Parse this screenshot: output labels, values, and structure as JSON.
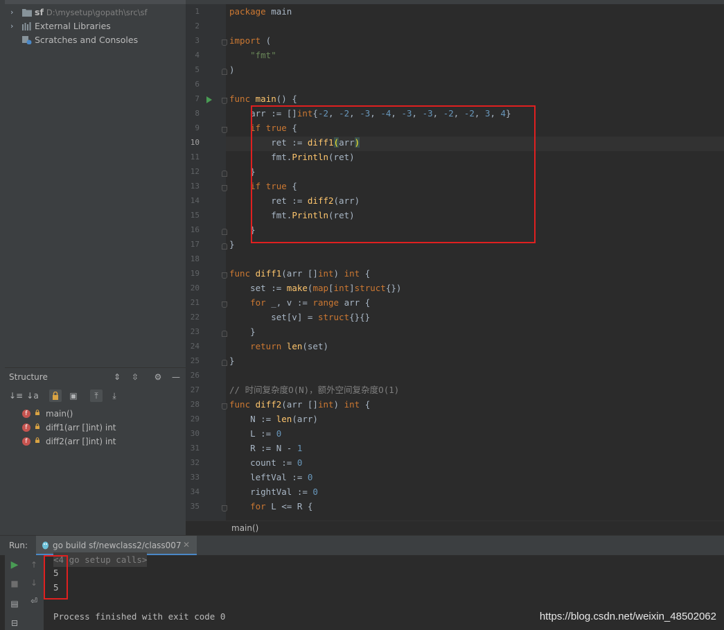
{
  "project": {
    "items": [
      {
        "name": "sf",
        "path": "D:\\mysetup\\gopath\\src\\sf"
      },
      {
        "name": "External Libraries"
      },
      {
        "name": "Scratches and Consoles"
      }
    ]
  },
  "structure": {
    "title": "Structure",
    "items": [
      {
        "badge": "f",
        "label": "main()"
      },
      {
        "badge": "f",
        "label": "diff1(arr []int) int"
      },
      {
        "badge": "f",
        "label": "diff2(arr []int) int"
      }
    ]
  },
  "editor": {
    "current_line": 10,
    "line_numbers": [
      "1",
      "2",
      "3",
      "4",
      "5",
      "6",
      "7",
      "8",
      "9",
      "10",
      "11",
      "12",
      "13",
      "14",
      "15",
      "16",
      "17",
      "18",
      "19",
      "20",
      "21",
      "22",
      "23",
      "24",
      "25",
      "26",
      "27",
      "28",
      "29",
      "30",
      "31",
      "32",
      "33",
      "34",
      "35"
    ],
    "breadcrumb": "main()"
  },
  "run": {
    "label": "Run:",
    "tab_title": "go build sf/newclass2/class007",
    "console": [
      "<4 go setup calls>",
      "5",
      "5",
      "",
      "Process finished with exit code 0"
    ]
  },
  "watermark": "https://blog.csdn.net/weixin_48502062",
  "colors": {
    "highlight_box": "#e02020",
    "keyword": "#cc7832",
    "function": "#ffc66d",
    "string": "#6a8759",
    "number": "#6897bb"
  }
}
